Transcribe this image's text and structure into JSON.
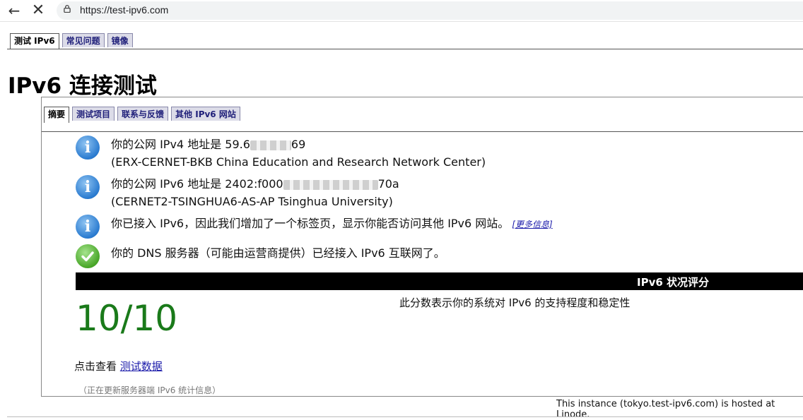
{
  "browser": {
    "url": "https://test-ipv6.com"
  },
  "top_tabs": [
    "测试 IPv6",
    "常见问题",
    "镜像"
  ],
  "page_title": "IPv6 连接测试",
  "sub_tabs": [
    "摘要",
    "测试项目",
    "联系与反馈",
    "其他 IPv6 网站"
  ],
  "results": [
    {
      "line1_prefix": "你的公网 IPv4 地址是 59.6",
      "line1_suffix": "69",
      "line2": "(ERX-CERNET-BKB China Education and Research Network Center)"
    },
    {
      "line1_prefix": "你的公网 IPv6 地址是 2402:f000",
      "line1_suffix": "70a",
      "line2": "(CERNET2-TSINGHUA6-AS-AP Tsinghua University)"
    },
    {
      "text": "你已接入 IPv6，因此我们增加了一个标签页，显示你能否访问其他 IPv6 网站。",
      "link": "[更多信息]"
    },
    {
      "text": "你的 DNS 服务器（可能由运营商提供）已经接入 IPv6 互联网了。"
    }
  ],
  "score": {
    "header": "IPv6 状况评分",
    "value": "10/10",
    "description": "此分数表示你的系统对 IPv6 的支持程度和稳定性"
  },
  "view_data": {
    "prefix": "点击查看 ",
    "link": "测试数据"
  },
  "updating_text": "（正在更新服务器端 IPv6 统计信息）",
  "footer_text": "This instance (tokyo.test-ipv6.com) is hosted at Linode."
}
